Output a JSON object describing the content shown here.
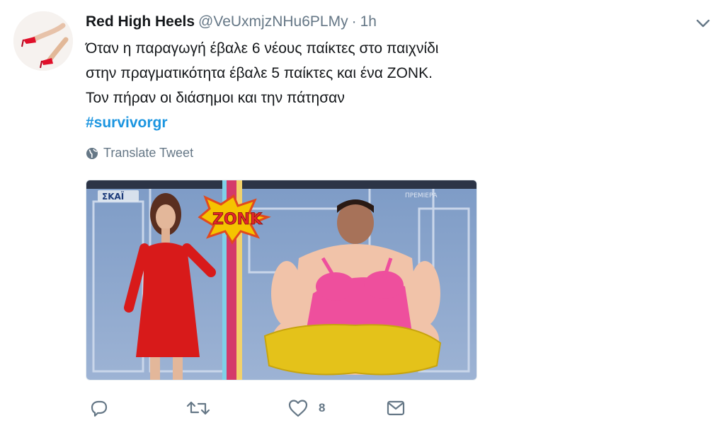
{
  "tweet": {
    "display_name": "Red High Heels",
    "handle": "@VeUxmjzNHu6PLMy",
    "separator": "·",
    "time": "1h",
    "lines": [
      "Όταν η παραγωγή έβαλε 6 νέους παίκτες στο παιχνίδι",
      "στην πραγματικότητα έβαλε 5 παίκτες και ένα ZONK.",
      "Τον πήραν οι διάσημοι και την πάτησαν"
    ],
    "hashtag": "#survivorgr",
    "translate_label": "Translate Tweet"
  },
  "media": {
    "channel_logo": "ΣΚΑΪ",
    "corner_label": "ΠΡΕΜΙΕΡΑ",
    "sign_text": "ZONK"
  },
  "actions": {
    "like_count": "8"
  },
  "icons": {
    "reply": "reply-icon",
    "retweet": "retweet-icon",
    "like": "heart-icon",
    "dm": "envelope-icon",
    "globe": "globe-icon",
    "caret": "chevron-down-icon"
  },
  "colors": {
    "accent": "#1b95e0",
    "muted": "#657786",
    "text": "#14171a"
  }
}
